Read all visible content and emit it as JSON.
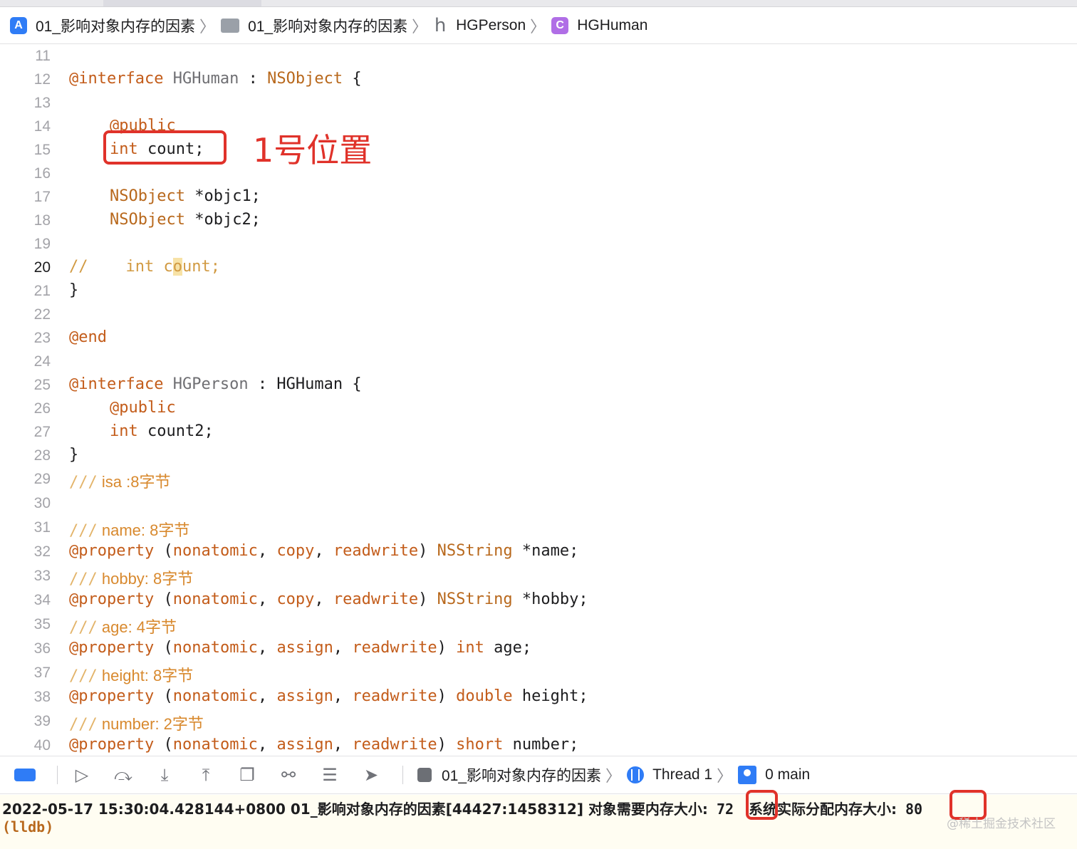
{
  "breadcrumb": {
    "project": "01_影响对象内存的因素",
    "folder": "01_影响对象内存的因素",
    "file_icon_letter": "h",
    "file": "HGPerson",
    "symbol_icon_letter": "C",
    "symbol": "HGHuman",
    "separator": "〉"
  },
  "editor": {
    "current_line": 20,
    "lines": [
      {
        "n": "11"
      },
      {
        "n": "12"
      },
      {
        "n": "13"
      },
      {
        "n": "14"
      },
      {
        "n": "15"
      },
      {
        "n": "16"
      },
      {
        "n": "17"
      },
      {
        "n": "18"
      },
      {
        "n": "19"
      },
      {
        "n": "20"
      },
      {
        "n": "21"
      },
      {
        "n": "22"
      },
      {
        "n": "23"
      },
      {
        "n": "24"
      },
      {
        "n": "25"
      },
      {
        "n": "26"
      },
      {
        "n": "27"
      },
      {
        "n": "28"
      },
      {
        "n": "29"
      },
      {
        "n": "30"
      },
      {
        "n": "31"
      },
      {
        "n": "32"
      },
      {
        "n": "33"
      },
      {
        "n": "34"
      },
      {
        "n": "35"
      },
      {
        "n": "36"
      },
      {
        "n": "37"
      },
      {
        "n": "38"
      },
      {
        "n": "39"
      },
      {
        "n": "40"
      }
    ],
    "tokens": {
      "interface": "@interface",
      "public": "@public",
      "end": "@end",
      "property": "@property",
      "nsobject": "NSObject",
      "hghuman": "HGHuman",
      "hgperson": "HGPerson",
      "int": "int",
      "double": "double",
      "short": "short",
      "nsstring": "NSString",
      "nonatomic": "nonatomic",
      "copy": "copy",
      "assign": "assign",
      "readwrite": "readwrite",
      "doc_prefix": "///",
      "line_comment": "//"
    },
    "code_text": {
      "l12_colon": " : ",
      "l12_brace": " {",
      "l15_rest": " count;",
      "l17_rest": " *objc1;",
      "l18_rest": " *objc2;",
      "l20_pad": "    ",
      "l20_c": " c",
      "l20_o": "o",
      "l20_rest": "unt;",
      "close_brace": "}",
      "l25_colon": " : ",
      "l25_brace": " {",
      "l27_rest": " count2;",
      "doc29": " isa :8字节",
      "doc31": " name: 8字节",
      "doc33": " hobby: 8字节",
      "doc35": " age: 4字节",
      "doc37": " height: 8字节",
      "doc39": " number: 2字节",
      "p_open": " (",
      "p_comma": ", ",
      "p_close": ") ",
      "name32": " *name;",
      "name34": " *hobby;",
      "name36": " age;",
      "name38": " height;",
      "name40": " number;"
    },
    "annotation": "1号位置"
  },
  "debug_bar": {
    "process": "01_影响对象内存的因素",
    "thread": "Thread 1",
    "frame": "0 main",
    "separator": "〉"
  },
  "console": {
    "log_prefix": "2022-05-17 15:30:04.428144+0800 01_影响对象内存的因素[44427:1458312] ",
    "label_required": "对象需要内存大小:",
    "value_required": "72",
    "label_actual": "系统实际分配内存大小:",
    "value_actual": "80",
    "prompt": "(lldb)"
  },
  "watermark": "@稀土掘金技术社区",
  "colors": {
    "keyword": "#c35c1a",
    "type": "#b8681c",
    "comment": "#d19a42",
    "highlight_box": "#e0322a",
    "accent_blue": "#2f7cf6"
  }
}
